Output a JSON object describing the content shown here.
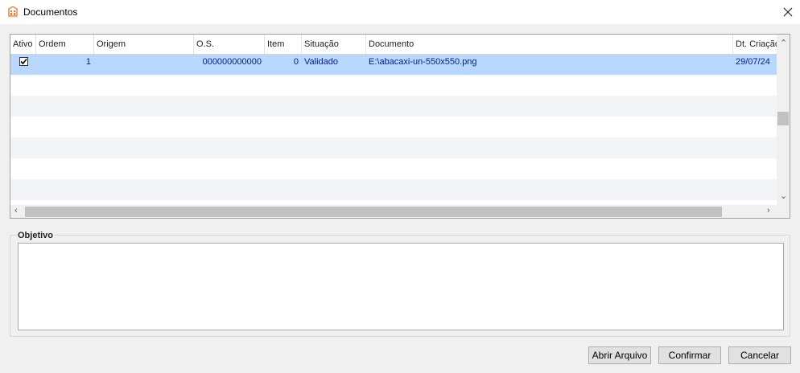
{
  "window": {
    "title": "Documentos",
    "icon": "app-logo-icon",
    "close_icon": "close-icon"
  },
  "grid": {
    "columns": [
      "Ativo",
      "Ordem",
      "Origem",
      "O.S.",
      "Item",
      "Situação",
      "Documento",
      "Dt. Criação"
    ],
    "rows": [
      {
        "ativo": true,
        "ordem": "1",
        "origem": "",
        "os": "000000000000",
        "item": "0",
        "situacao": "Validado",
        "documento": "E:\\abacaxi-un-550x550.png",
        "dt_criacao": "29/07/24"
      }
    ]
  },
  "objetivo": {
    "label": "Objetivo",
    "value": ""
  },
  "buttons": {
    "abrir_arquivo": "Abrir Arquivo",
    "confirmar": "Confirmar",
    "cancelar": "Cancelar"
  },
  "colors": {
    "selected_row": "#b8d7fb",
    "alt_row": "#f2f4f7",
    "cell_text": "#0a1a8a"
  }
}
